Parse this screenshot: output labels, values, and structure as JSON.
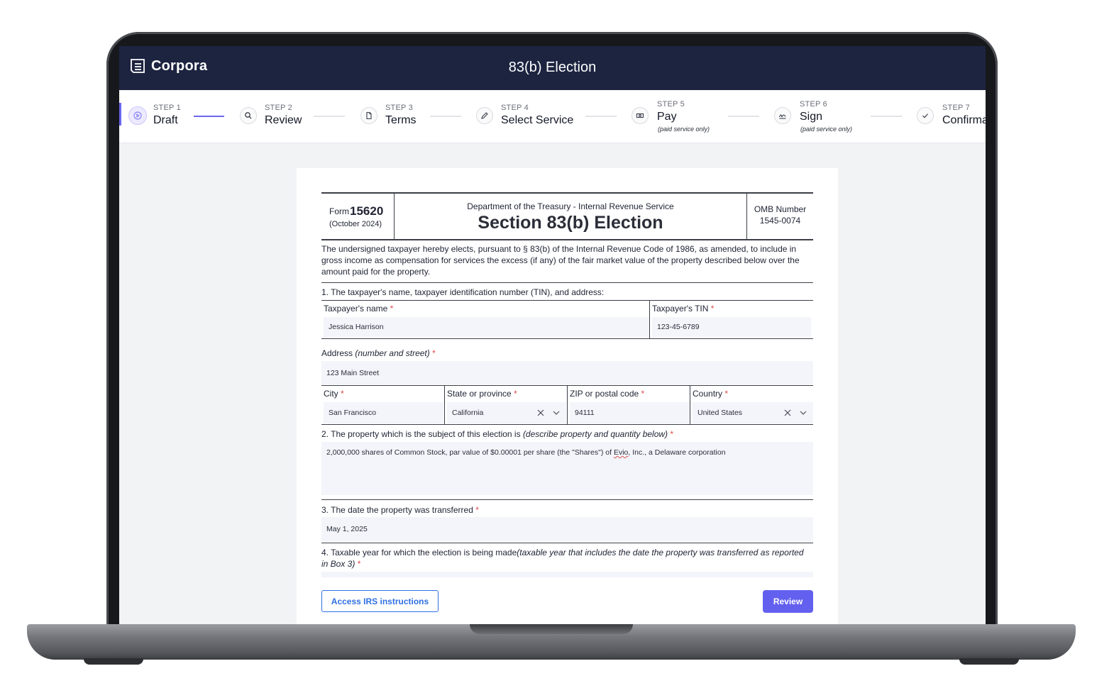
{
  "app": {
    "brand": "Corpora",
    "title": "83(b) Election"
  },
  "steps": [
    {
      "label": "STEP 1",
      "name": "Draft",
      "note": "",
      "icon": "play-icon",
      "status": "active"
    },
    {
      "label": "STEP 2",
      "name": "Review",
      "note": "",
      "icon": "search-icon",
      "status": "pending"
    },
    {
      "label": "STEP 3",
      "name": "Terms",
      "note": "",
      "icon": "document-icon",
      "status": "pending"
    },
    {
      "label": "STEP 4",
      "name": "Select Service",
      "note": "",
      "icon": "pencil-icon",
      "status": "pending"
    },
    {
      "label": "STEP 5",
      "name": "Pay",
      "note": "(paid service only)",
      "icon": "cash-icon",
      "status": "pending"
    },
    {
      "label": "STEP 6",
      "name": "Sign",
      "note": "(paid service only)",
      "icon": "signature-icon",
      "status": "pending"
    },
    {
      "label": "STEP 7",
      "name": "Confirma",
      "note": "",
      "icon": "check-icon",
      "status": "pending"
    }
  ],
  "form": {
    "form_word": "Form",
    "form_number": "15620",
    "form_date": "(October 2024)",
    "department": "Department of the Treasury - Internal Revenue Service",
    "title": "Section 83(b) Election",
    "omb_label": "OMB Number",
    "omb_number": "1545-0074",
    "intro": "The undersigned taxpayer hereby elects, pursuant to § 83(b) of the Internal Revenue Code of 1986, as amended, to include in gross income as compensation for services the excess (if any) of the fair market value of the property described below over the amount paid for the property.",
    "q1": "1. The taxpayer's name, taxpayer identification number (TIN), and address:",
    "name_label": "Taxpayer's name",
    "name_value": "Jessica Harrison",
    "tin_label": "Taxpayer's TIN",
    "tin_value": "123-45-6789",
    "address_label": "Address",
    "address_hint": "(number and street)",
    "address_value": "123 Main Street",
    "city_label": "City",
    "city_value": "San Francisco",
    "state_label": "State or province",
    "state_value": "California",
    "zip_label": "ZIP or postal code",
    "zip_value": "94111",
    "country_label": "Country",
    "country_value": "United States",
    "q2": "2. The property which is the subject of this election is",
    "q2_hint": "(describe property and quantity below)",
    "property_pre": "2,000,000 shares of Common Stock, par value of $0.00001 per share (the \"Shares\") of",
    "property_company": "Evio",
    "property_post": ", Inc., a Delaware corporation",
    "q3": "3. The date the property was transferred",
    "date_value": "May 1, 2025",
    "q4": "4. Taxable year for which the election is being made",
    "q4_hint_a": "(taxable year that includes the date the property was transferred as reported",
    "q4_hint_b": "in Box 3)",
    "required_mark": "*"
  },
  "buttons": {
    "instructions": "Access IRS instructions",
    "review": "Review"
  },
  "colors": {
    "topbar": "#1d2440",
    "accent": "#6360ef",
    "link": "#2f6fe0",
    "required": "#e04848",
    "field_bg": "#f3f5fa"
  }
}
